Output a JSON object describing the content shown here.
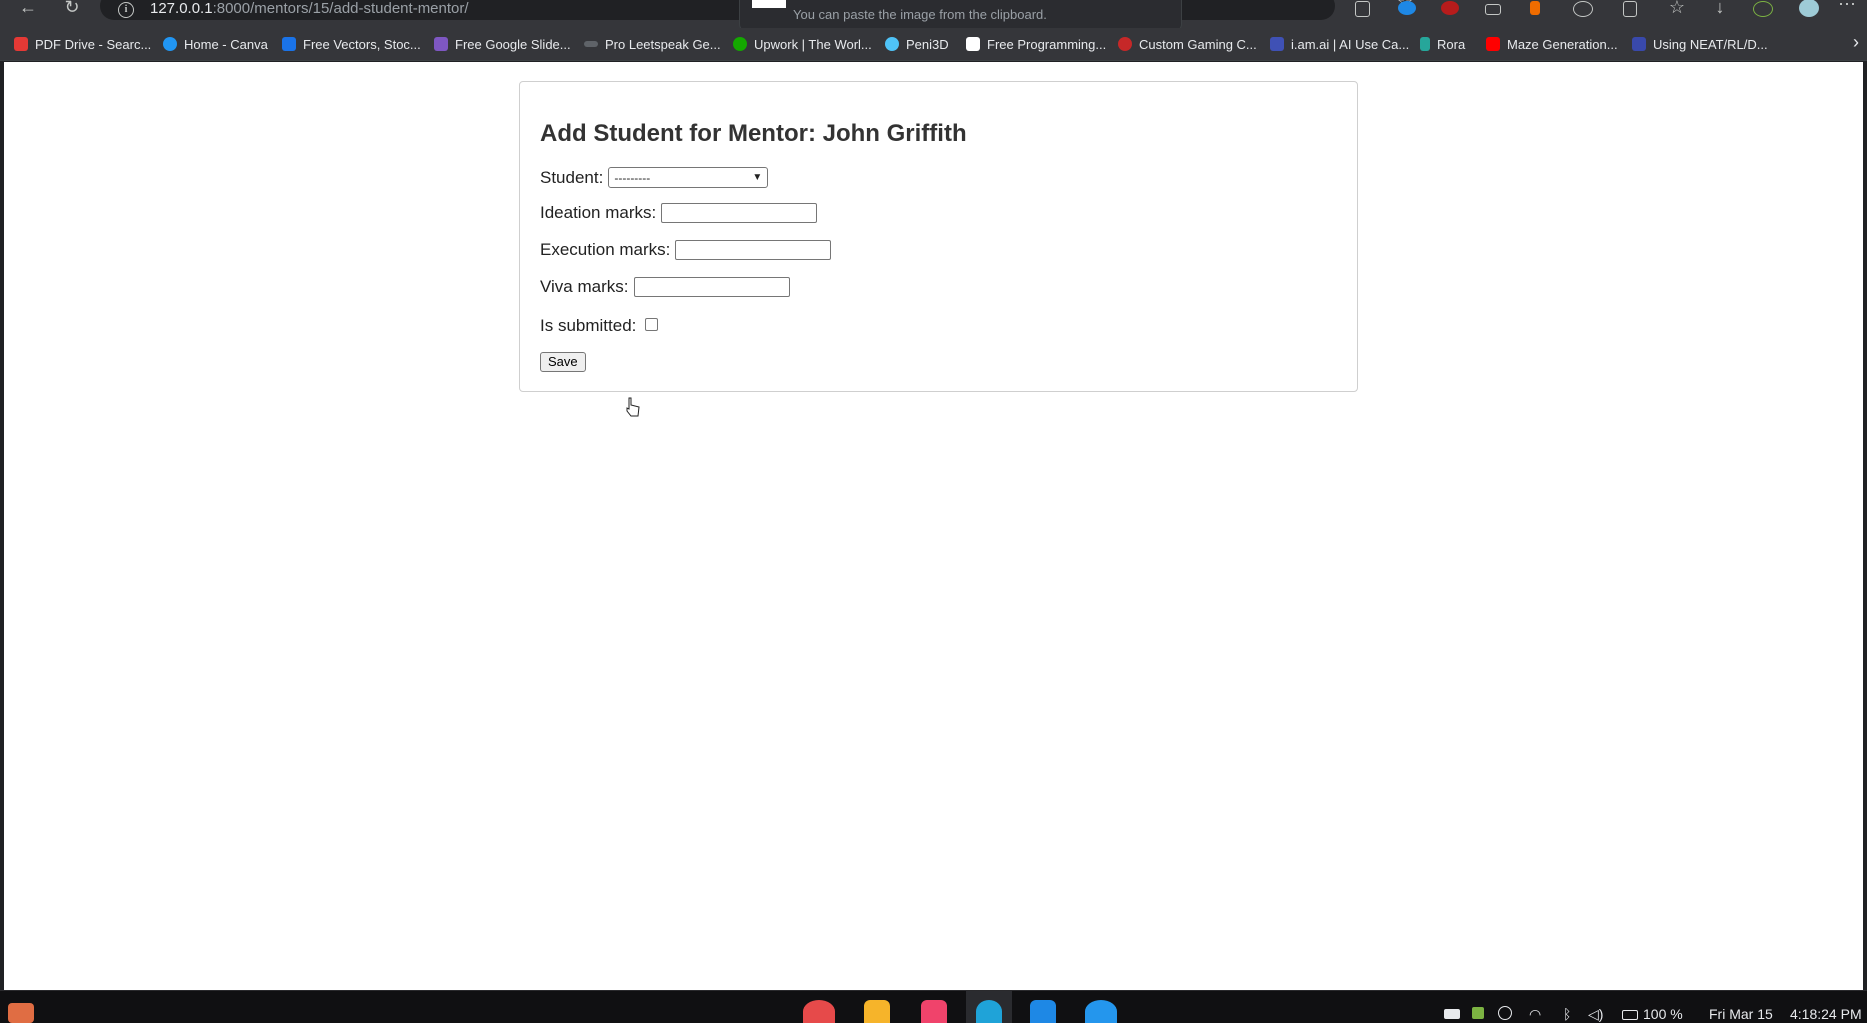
{
  "browser": {
    "url_host": "127.0.0.1",
    "url_path": ":8000/mentors/15/add-student-mentor/",
    "paste_hint": "You can paste the image from the clipboard."
  },
  "bookmarks": [
    {
      "label": "PDF Drive - Searc...",
      "color": "#e53935"
    },
    {
      "label": "Home - Canva",
      "color": "#2196f3"
    },
    {
      "label": "Free Vectors, Stoc...",
      "color": "#1a73e8"
    },
    {
      "label": "Free Google Slide...",
      "color": "#7e57c2"
    },
    {
      "label": "Pro Leetspeak Ge...",
      "color": "#5f6368"
    },
    {
      "label": "Upwork | The Worl...",
      "color": "#14a800"
    },
    {
      "label": "Peni3D",
      "color": "#4fc3f7"
    },
    {
      "label": "Free Programming...",
      "color": "#ffffff"
    },
    {
      "label": "Custom Gaming C...",
      "color": "#c62828"
    },
    {
      "label": "i.am.ai | AI Use Ca...",
      "color": "#3f51b5"
    },
    {
      "label": "Rora",
      "color": "#26a69a"
    },
    {
      "label": "Maze Generation...",
      "color": "#ff0000"
    },
    {
      "label": "Using NEAT/RL/D...",
      "color": "#3949ab"
    }
  ],
  "form": {
    "title": "Add Student for Mentor: John Griffith",
    "student_label": "Student:",
    "student_selected": "---------",
    "ideation_label": "Ideation marks:",
    "ideation_value": "",
    "execution_label": "Execution marks:",
    "execution_value": "",
    "viva_label": "Viva marks:",
    "viva_value": "",
    "submitted_label": "Is submitted:",
    "submitted_checked": false,
    "save_label": "Save"
  },
  "tray": {
    "battery": "100 %",
    "date": "Fri Mar 15",
    "time": "4:18:24 PM"
  },
  "taskbar_apps": [
    {
      "name": "screenshot-app",
      "color": "#e64a4a"
    },
    {
      "name": "files-app",
      "color": "#f6b42a"
    },
    {
      "name": "music-app",
      "color": "#f0436b"
    },
    {
      "name": "edge-browser",
      "color": "#1fa3d8"
    },
    {
      "name": "vscode",
      "color": "#1e88e5"
    },
    {
      "name": "docker-app",
      "color": "#2496ed"
    }
  ]
}
